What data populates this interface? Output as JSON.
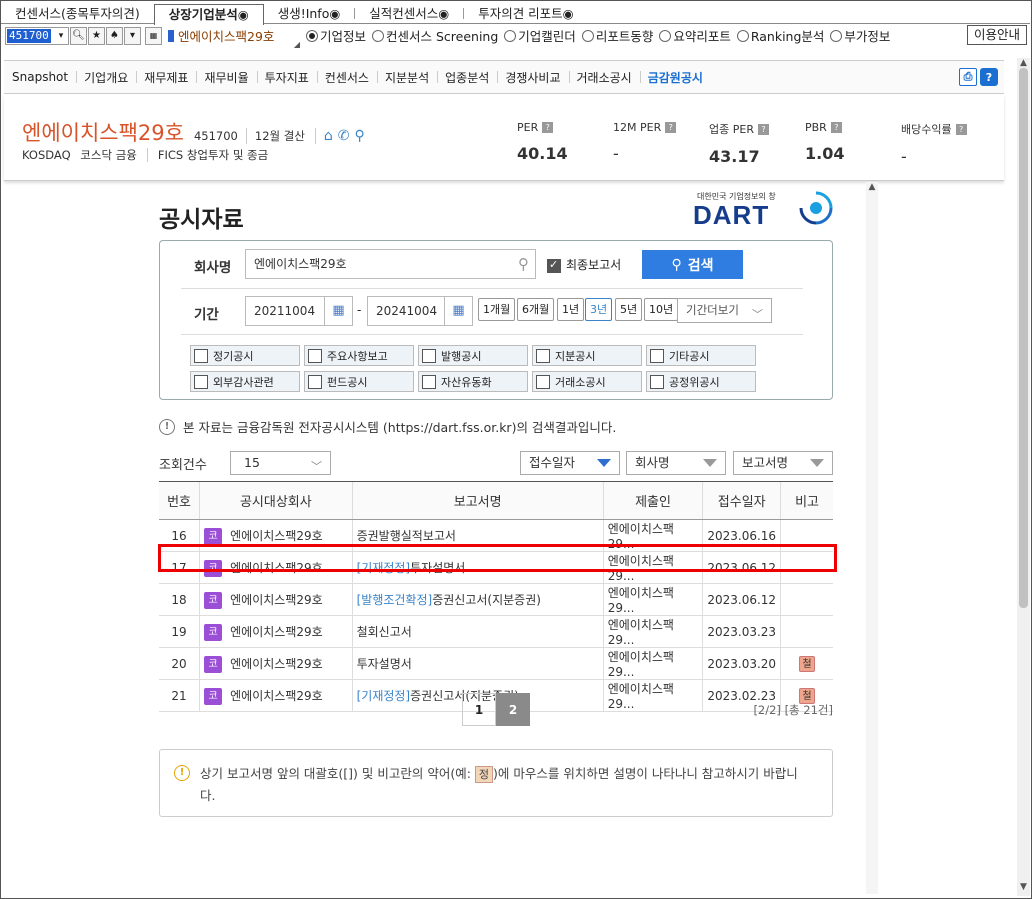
{
  "topbar": {
    "tabs": [
      "컨센서스(종목투자의견)",
      "상장기업분석◉",
      "생생!Info◉",
      "실적컨센서스◉",
      "투자의견 리포트◉"
    ],
    "active": 1
  },
  "toolbar": {
    "code": "451700",
    "company": "엔에이치스팩29호",
    "radios": [
      "기업정보",
      "컨센서스 Screening",
      "기업캘린더",
      "리포트동향",
      "요약리포트",
      "Ranking분석",
      "부가정보"
    ],
    "help": "이용안내"
  },
  "menu": {
    "items": [
      "Snapshot",
      "기업개요",
      "재무제표",
      "재무비율",
      "투자지표",
      "컨센서스",
      "지분분석",
      "업종분석",
      "경쟁사비교",
      "거래소공시",
      "금감원공시"
    ],
    "active": 10
  },
  "company": {
    "name": "엔에이치스팩29호",
    "code": "451700",
    "settle": "12월 결산",
    "market": "KOSDAQ",
    "market_sector": "코스닥 금융",
    "fics": "FICS 창업투자 및 종금"
  },
  "metrics": [
    {
      "label": "PER",
      "value": "40.14"
    },
    {
      "label": "12M PER",
      "value": "-"
    },
    {
      "label": "업종 PER",
      "value": "43.17"
    },
    {
      "label": "PBR",
      "value": "1.04"
    },
    {
      "label": "배당수익률",
      "value": "-"
    }
  ],
  "page": {
    "title": "공시자료",
    "dart_small": "대한민국 기업정보의 창",
    "dart": "DART"
  },
  "search": {
    "company_label": "회사명",
    "company_value": "엔에이치스팩29호",
    "final_label": "최종보고서",
    "button": "검색",
    "period_label": "기간",
    "from": "20211004",
    "to": "20241004",
    "periods": [
      "1개월",
      "6개월",
      "1년",
      "3년",
      "5년",
      "10년"
    ],
    "period_selected": 3,
    "more": "기간더보기",
    "cats": [
      "정기공시",
      "주요사항보고",
      "발행공시",
      "지분공시",
      "기타공시",
      "외부감사관련",
      "펀드공시",
      "자산유동화",
      "거래소공시",
      "공정위공시"
    ]
  },
  "notice": "본 자료는 금융감독원 전자공시시스템 (https://dart.fss.or.kr)의 검색결과입니다.",
  "list": {
    "count_label": "조회건수",
    "count": "15",
    "sorts": [
      "접수일자",
      "회사명",
      "보고서명"
    ],
    "headers": [
      "번호",
      "공시대상회사",
      "보고서명",
      "제출인",
      "접수일자",
      "비고"
    ],
    "rows": [
      {
        "no": "16",
        "badge": "코",
        "company": "엔에이치스팩29호",
        "prefix": "",
        "report": "증권발행실적보고서",
        "submitter": "엔에이치스팩29...",
        "date": "2023.06.16",
        "remark": ""
      },
      {
        "no": "17",
        "badge": "코",
        "company": "엔에이치스팩29호",
        "prefix": "[기재정정]",
        "report": "투자설명서",
        "submitter": "엔에이치스팩29...",
        "date": "2023.06.12",
        "remark": ""
      },
      {
        "no": "18",
        "badge": "코",
        "company": "엔에이치스팩29호",
        "prefix": "[발행조건확정]",
        "report": "증권신고서(지분증권)",
        "submitter": "엔에이치스팩29...",
        "date": "2023.06.12",
        "remark": ""
      },
      {
        "no": "19",
        "badge": "코",
        "company": "엔에이치스팩29호",
        "prefix": "",
        "report": "철회신고서",
        "submitter": "엔에이치스팩29...",
        "date": "2023.03.23",
        "remark": ""
      },
      {
        "no": "20",
        "badge": "코",
        "company": "엔에이치스팩29호",
        "prefix": "",
        "report": "투자설명서",
        "submitter": "엔에이치스팩29...",
        "date": "2023.03.20",
        "remark": "철"
      },
      {
        "no": "21",
        "badge": "코",
        "company": "엔에이치스팩29호",
        "prefix": "[기재정정]",
        "report": "증권신고서(지분증권)",
        "submitter": "엔에이치스팩29...",
        "date": "2023.02.23",
        "remark": "철"
      }
    ]
  },
  "pager": {
    "pages": [
      "1",
      "2"
    ],
    "current": 1,
    "info": "[2/2] [총 21건]"
  },
  "tip": {
    "text1": "상기 보고서명 앞의 대괄호([]) 및 비고란의 약어(예: ",
    "badge": "정",
    "text2": ")에 마우스를 위치하면 설명이 나타나니 참고하시기 바랍니다."
  }
}
